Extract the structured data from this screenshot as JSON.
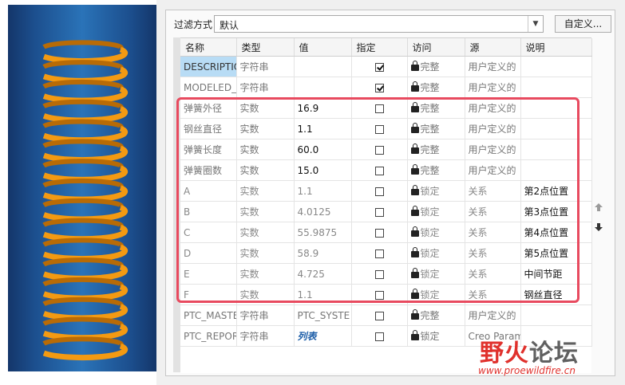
{
  "filter": {
    "label": "过滤方式",
    "selected": "默认",
    "custom_button": "自定义..."
  },
  "columns": [
    "名称",
    "类型",
    "值",
    "指定",
    "访问",
    "源",
    "说明"
  ],
  "rows": [
    {
      "name": "DESCRIPTIO",
      "type": "字符串",
      "value": "",
      "designated": true,
      "access": "完整",
      "lock": true,
      "source": "用户定义的",
      "desc": "",
      "cls": "sys",
      "hl": true
    },
    {
      "name": "MODELED_",
      "type": "字符串",
      "value": "",
      "designated": true,
      "access": "完整",
      "lock": true,
      "source": "用户定义的",
      "desc": "",
      "cls": "sys",
      "hl": false
    },
    {
      "name": "弹簧外径",
      "type": "实数",
      "value": "16.9",
      "designated": false,
      "access": "完整",
      "lock": true,
      "source": "用户定义的",
      "desc": "",
      "cls": "real",
      "hl": false
    },
    {
      "name": "钢丝直径",
      "type": "实数",
      "value": "1.1",
      "designated": false,
      "access": "完整",
      "lock": true,
      "source": "用户定义的",
      "desc": "",
      "cls": "real",
      "hl": false
    },
    {
      "name": "弹簧长度",
      "type": "实数",
      "value": "60.0",
      "designated": false,
      "access": "完整",
      "lock": true,
      "source": "用户定义的",
      "desc": "",
      "cls": "real",
      "hl": false
    },
    {
      "name": "弹簧圈数",
      "type": "实数",
      "value": "15.0",
      "designated": false,
      "access": "完整",
      "lock": true,
      "source": "用户定义的",
      "desc": "",
      "cls": "real",
      "hl": false
    },
    {
      "name": "A",
      "type": "实数",
      "value": "1.1",
      "designated": false,
      "access": "锁定",
      "lock": true,
      "source": "关系",
      "desc": "第2点位置",
      "cls": "rel",
      "hl": false
    },
    {
      "name": "B",
      "type": "实数",
      "value": "4.0125",
      "designated": false,
      "access": "锁定",
      "lock": true,
      "source": "关系",
      "desc": "第3点位置",
      "cls": "rel",
      "hl": false
    },
    {
      "name": "C",
      "type": "实数",
      "value": "55.9875",
      "designated": false,
      "access": "锁定",
      "lock": true,
      "source": "关系",
      "desc": "第4点位置",
      "cls": "rel",
      "hl": false
    },
    {
      "name": "D",
      "type": "实数",
      "value": "58.9",
      "designated": false,
      "access": "锁定",
      "lock": true,
      "source": "关系",
      "desc": "第5点位置",
      "cls": "rel",
      "hl": false
    },
    {
      "name": "E",
      "type": "实数",
      "value": "4.725",
      "designated": false,
      "access": "锁定",
      "lock": true,
      "source": "关系",
      "desc": "中间节距",
      "cls": "rel",
      "hl": false
    },
    {
      "name": "F",
      "type": "实数",
      "value": "1.1",
      "designated": false,
      "access": "锁定",
      "lock": true,
      "source": "关系",
      "desc": "钢丝直径",
      "cls": "rel",
      "hl": false
    },
    {
      "name": "PTC_MASTE",
      "type": "字符串",
      "value": "PTC_SYSTE",
      "designated": false,
      "access": "完整",
      "lock": true,
      "source": "用户定义的",
      "desc": "",
      "cls": "sys",
      "hl": false
    },
    {
      "name": "PTC_REPOR",
      "type": "字符串",
      "value": "列表",
      "designated": false,
      "access": "锁定",
      "lock": true,
      "source": "Creo Param",
      "desc": "",
      "cls": "sys",
      "hl": false,
      "link": true
    }
  ],
  "watermark": {
    "brand_a": "野火",
    "brand_b": "论坛",
    "url": "www.proewildfire.cn"
  },
  "colors": {
    "spring": "#f39a12",
    "viewport": "#1c4f8e",
    "highlight_box": "#e84a5f",
    "cell_selected": "#b8dcf5"
  },
  "icons": {
    "lock": "lock-icon",
    "move_up": "arrow-up-icon",
    "move_down": "arrow-down-icon",
    "dropdown": "chevron-down-icon"
  }
}
